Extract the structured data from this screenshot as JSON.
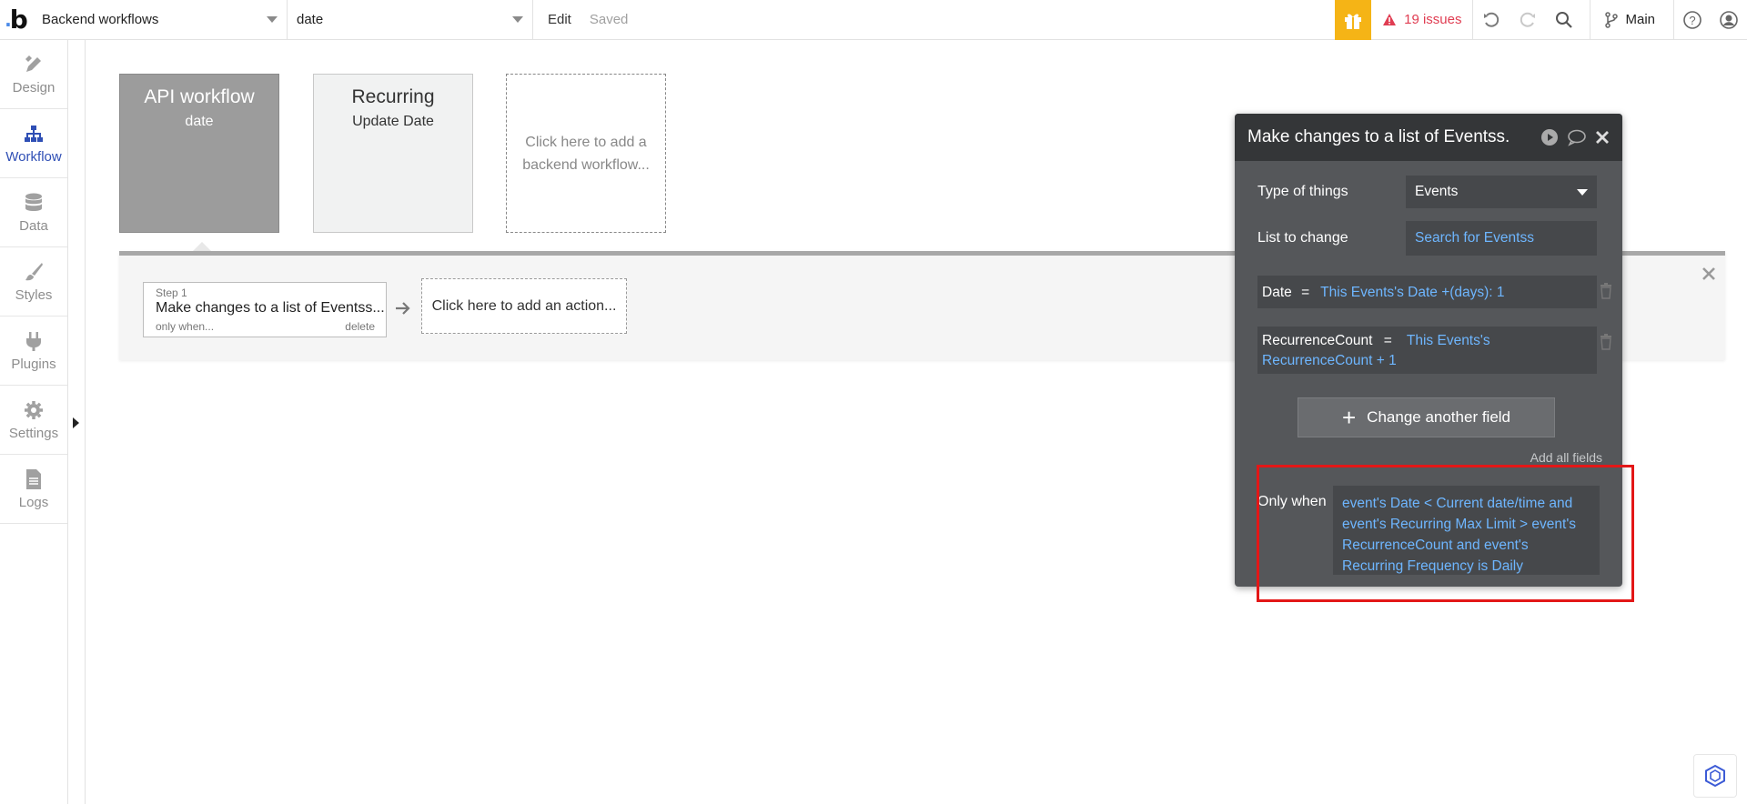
{
  "topbar": {
    "app_dropdown": "Backend workflows",
    "page_dropdown": "date",
    "edit_label": "Edit",
    "saved_label": "Saved",
    "issues_label": "19 issues",
    "branch_label": "Main"
  },
  "sidebar": {
    "items": [
      {
        "label": "Design",
        "icon": "design-pencil-icon"
      },
      {
        "label": "Workflow",
        "icon": "workflow-sitemap-icon"
      },
      {
        "label": "Data",
        "icon": "database-icon"
      },
      {
        "label": "Styles",
        "icon": "brush-icon"
      },
      {
        "label": "Plugins",
        "icon": "plug-icon"
      },
      {
        "label": "Settings",
        "icon": "gear-icon"
      },
      {
        "label": "Logs",
        "icon": "document-icon"
      }
    ]
  },
  "workflows": {
    "api": {
      "title": "API workflow",
      "subtitle": "date"
    },
    "recurring": {
      "title": "Recurring",
      "subtitle": "Update Date"
    },
    "add_label": "Click here to add a backend workflow..."
  },
  "step": {
    "label": "Step 1",
    "title": "Make changes to a list of Eventss...",
    "only_when": "only when...",
    "delete": "delete",
    "add_action": "Click here to add an action..."
  },
  "panel": {
    "title": "Make changes to a list of Eventss.",
    "type_label": "Type of things",
    "type_value": "Events",
    "list_label": "List to change",
    "list_value": "Search for Eventss",
    "field1_key": "Date",
    "field1_eq": "=",
    "field1_value": "This Events's Date +(days): 1",
    "field2_key": "RecurrenceCount",
    "field2_eq": "=",
    "field2_value": "This Events's RecurrenceCount + 1",
    "change_button": "Change another field",
    "add_all": "Add all fields",
    "only_when_label": "Only when",
    "only_when_value": "event's Date < Current date/time and event's Recurring Max Limit > event's RecurrenceCount and event's Recurring Frequency is Daily"
  },
  "colors": {
    "accent_blue": "#6eb6ff",
    "active_nav": "#2f4fb5",
    "issues_red": "#e03d52",
    "gift_yellow": "#f5b416",
    "highlight_red": "#e31717"
  }
}
